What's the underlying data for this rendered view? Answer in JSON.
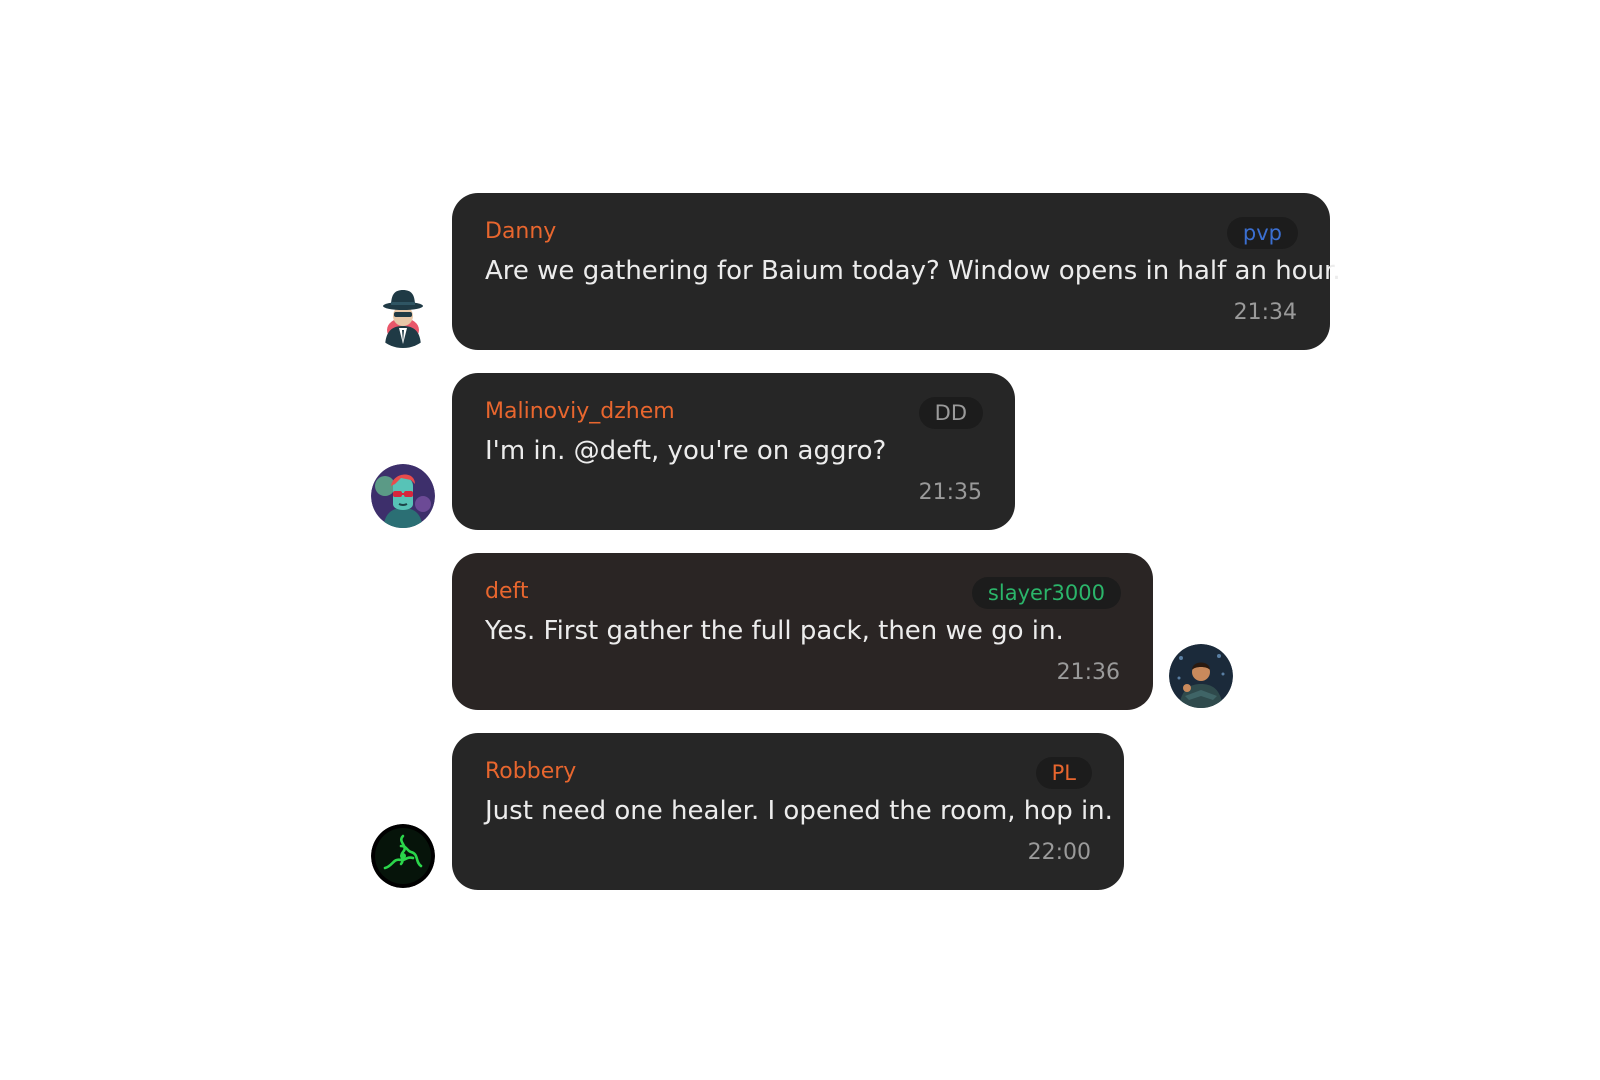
{
  "messages": [
    {
      "author": "Danny",
      "tag": "pvp",
      "tag_color": "#3b6fd1",
      "text": "Are we gathering for Baium today? Window opens in half an hour.",
      "time": "21:34",
      "avatar_icon": "spy-hat-avatar-icon"
    },
    {
      "author": "Malinoviy_dzhem",
      "tag": "DD",
      "tag_color": "#9a9a9a",
      "text": "I'm in. @deft, you're on aggro?",
      "time": "21:35",
      "avatar_icon": "sunglasses-portrait-avatar-icon"
    },
    {
      "author": "deft",
      "tag": "slayer3000",
      "tag_color": "#2bb56a",
      "text": "Yes. First gather the full pack, then we go in.",
      "time": "21:36",
      "avatar_icon": "man-portrait-avatar-icon"
    },
    {
      "author": "Robbery",
      "tag": "PL",
      "tag_color": "#e8662e",
      "text": "Just need one healer. I opened the room, hop in.",
      "time": "22:00",
      "avatar_icon": "razer-snake-avatar-icon"
    }
  ],
  "colors": {
    "bubble": "#262626",
    "own_bubble": "#2a2524",
    "author": "#e8662e",
    "text": "#ececec",
    "time": "#9a9a9a"
  }
}
